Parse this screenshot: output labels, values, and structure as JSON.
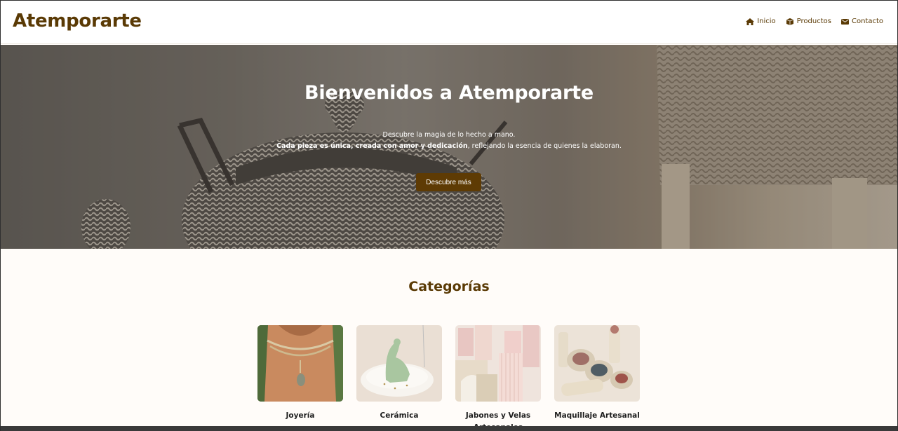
{
  "brand": "Atemporarte",
  "nav": [
    {
      "label": "Inicio",
      "icon": "home-icon"
    },
    {
      "label": "Productos",
      "icon": "box-icon"
    },
    {
      "label": "Contacto",
      "icon": "envelope-icon"
    }
  ],
  "hero": {
    "title": "Bienvenidos a Atemporarte",
    "line1": "Descubre la magia de lo hecho a mano.",
    "line2_bold": "Cada pieza es única, creada con amor y dedicación",
    "line2_rest": ", reflejando la esencia de quienes la elaboran.",
    "button": "Descubre más"
  },
  "categories": {
    "title": "Categorías",
    "items": [
      {
        "label": "Joyería"
      },
      {
        "label": "Cerámica"
      },
      {
        "label": "Jabones y Velas Artesanales"
      },
      {
        "label": "Maquillaje Artesanal"
      }
    ]
  },
  "colors": {
    "brand": "#5a3a05",
    "button": "#5e3b04",
    "background": "#fffcf9"
  }
}
